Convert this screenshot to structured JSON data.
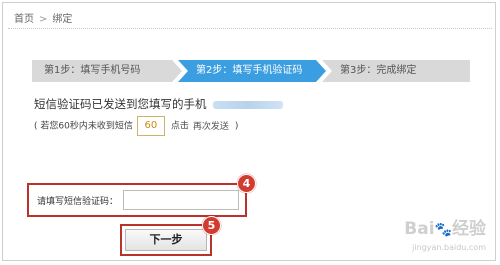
{
  "breadcrumb": {
    "home": "首页",
    "separator": ">",
    "current": "绑定"
  },
  "steps": [
    {
      "label": "第1步：填写手机号码",
      "state": "done"
    },
    {
      "label": "第2步：填写手机验证码",
      "state": "active"
    },
    {
      "label": "第3步：完成绑定",
      "state": "pending"
    }
  ],
  "sms": {
    "sent_text": "短信验证码已发送到您填写的手机",
    "resend_prefix": "( 若您60秒内未收到短信",
    "countdown": "60",
    "resend_click": "点击",
    "resend_link": "再次发送",
    "resend_suffix": ")"
  },
  "form": {
    "code_label": "请填写短信验证码：",
    "code_value": "",
    "next_label": "下一步"
  },
  "annotations": {
    "badge_4": "4",
    "badge_5": "5"
  },
  "watermark": {
    "main": "Bai",
    "paw": "🐾",
    "main2": "经验",
    "sub": "jingyan.baidu.com"
  },
  "colors": {
    "active_step": "#3b9ee1",
    "inactive_step": "#d9d9d9",
    "highlight": "#b9322b",
    "badge": "#d23b2f"
  }
}
